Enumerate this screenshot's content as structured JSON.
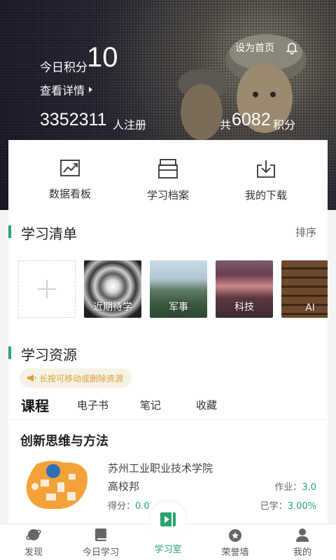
{
  "header": {
    "set_home": "设为首页",
    "today_points_label": "今日积分",
    "today_points_value": "10",
    "view_details": "查看详情",
    "registered_count": "3352311",
    "registered_label": "人注册",
    "total_prefix": "共",
    "total_points": "6082",
    "total_suffix": "积分"
  },
  "quick_actions": [
    {
      "label": "数据看板",
      "icon": "chart-icon"
    },
    {
      "label": "学习档案",
      "icon": "archive-icon"
    },
    {
      "label": "我的下载",
      "icon": "download-icon"
    }
  ],
  "study_list": {
    "title": "学习清单",
    "sort": "排序",
    "tiles": [
      "近期待学",
      "军事",
      "科技",
      "AI"
    ]
  },
  "resources": {
    "title": "学习资源",
    "tip": "长按可移动或删除资源",
    "tabs": [
      "课程",
      "电子书",
      "笔记",
      "收藏"
    ]
  },
  "course": {
    "title": "创新思维与方法",
    "school": "苏州工业职业技术学院",
    "org": "高校邦",
    "homework_label": "作业：",
    "homework_value": "3.0",
    "score_label": "得分：",
    "score_value": "0.0",
    "learned_label": "已学：",
    "learned_value": "3.00%"
  },
  "nav": {
    "items": [
      "发现",
      "今日学习",
      "学习室",
      "荣誉墙",
      "我的"
    ]
  },
  "colors": {
    "accent": "#27a56d",
    "tip": "#d8a238"
  }
}
